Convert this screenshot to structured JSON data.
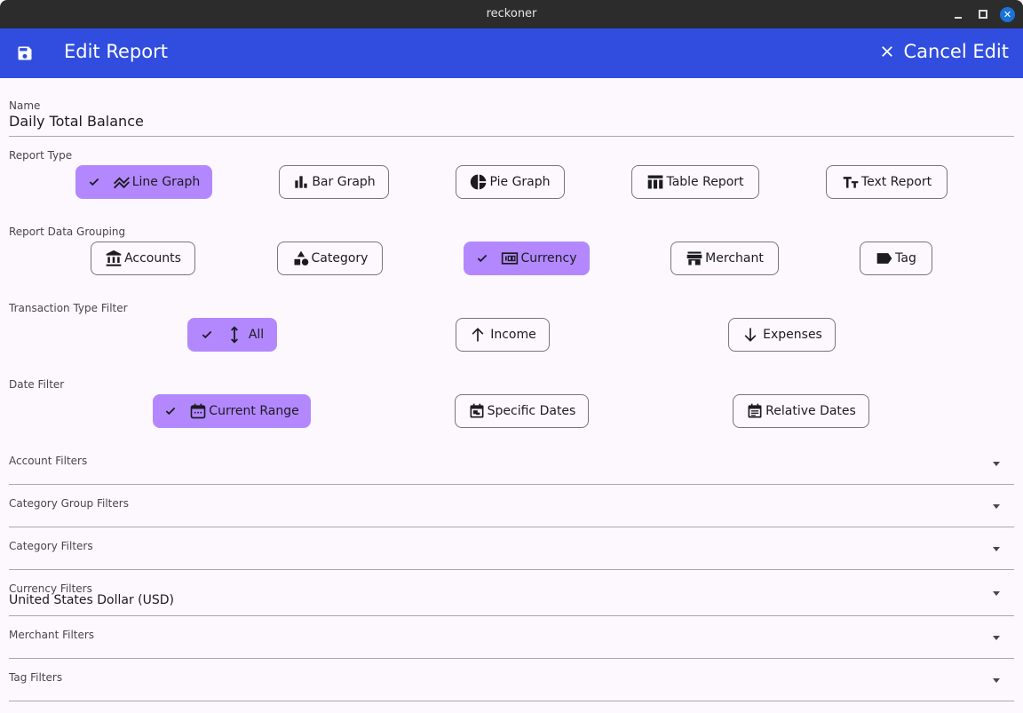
{
  "window": {
    "title": "reckoner",
    "controls": {
      "minimize": "minimize",
      "maximize": "maximize",
      "close": "✕"
    }
  },
  "appbar": {
    "title": "Edit Report",
    "save_icon": "save-icon",
    "cancel_label": "Cancel Edit",
    "cancel_icon": "close-icon",
    "color": "#304ddf"
  },
  "form": {
    "name": {
      "label": "Name",
      "value": "Daily Total Balance"
    },
    "report_type": {
      "label": "Report Type",
      "options": [
        {
          "label": "Line Graph",
          "icon": "line-graph-icon",
          "selected": true
        },
        {
          "label": "Bar Graph",
          "icon": "bar-graph-icon",
          "selected": false
        },
        {
          "label": "Pie Graph",
          "icon": "pie-graph-icon",
          "selected": false
        },
        {
          "label": "Table Report",
          "icon": "table-icon",
          "selected": false
        },
        {
          "label": "Text Report",
          "icon": "text-icon",
          "selected": false
        }
      ]
    },
    "grouping": {
      "label": "Report Data Grouping",
      "options": [
        {
          "label": "Accounts",
          "icon": "bank-icon",
          "selected": false
        },
        {
          "label": "Category",
          "icon": "category-icon",
          "selected": false
        },
        {
          "label": "Currency",
          "icon": "currency-icon",
          "selected": true
        },
        {
          "label": "Merchant",
          "icon": "store-icon",
          "selected": false
        },
        {
          "label": "Tag",
          "icon": "tag-icon",
          "selected": false
        }
      ]
    },
    "transaction_type": {
      "label": "Transaction Type Filter",
      "options": [
        {
          "label": "All",
          "icon": "up-down-arrow-icon",
          "selected": true
        },
        {
          "label": "Income",
          "icon": "arrow-up-icon",
          "selected": false
        },
        {
          "label": "Expenses",
          "icon": "arrow-down-icon",
          "selected": false
        }
      ]
    },
    "date_filter": {
      "label": "Date Filter",
      "options": [
        {
          "label": "Current Range",
          "icon": "calendar-range-icon",
          "selected": true
        },
        {
          "label": "Specific Dates",
          "icon": "calendar-specific-icon",
          "selected": false
        },
        {
          "label": "Relative Dates",
          "icon": "calendar-relative-icon",
          "selected": false
        }
      ]
    },
    "filters": [
      {
        "label": "Account Filters",
        "value": ""
      },
      {
        "label": "Category Group Filters",
        "value": ""
      },
      {
        "label": "Category Filters",
        "value": ""
      },
      {
        "label": "Currency Filters",
        "value": "United States Dollar (USD)"
      },
      {
        "label": "Merchant Filters",
        "value": ""
      },
      {
        "label": "Tag Filters",
        "value": ""
      }
    ],
    "selected_color": "#b388ff"
  }
}
